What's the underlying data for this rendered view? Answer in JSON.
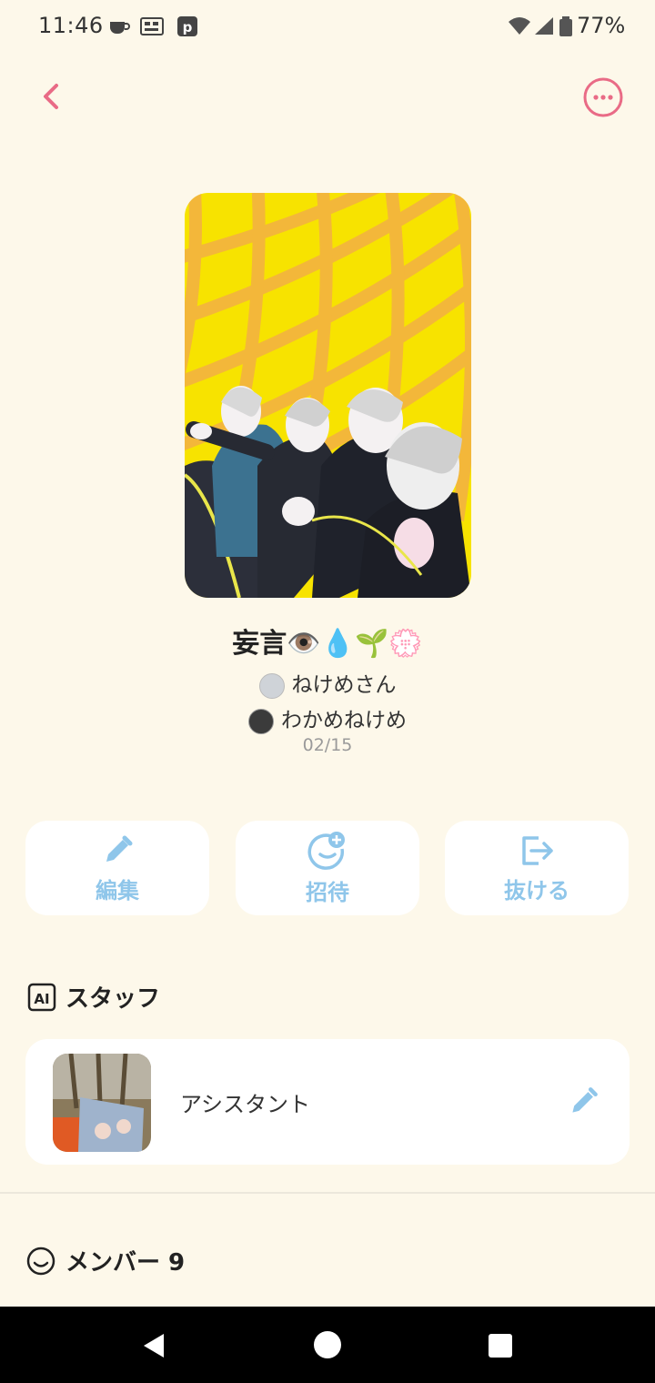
{
  "status_bar": {
    "time": "11:46",
    "battery": "77%",
    "icons": [
      "coffee-icon",
      "gallery-icon",
      "p-app-icon",
      "wifi-icon",
      "signal-icon",
      "battery-icon"
    ]
  },
  "header": {
    "back_icon": "chevron-left-icon",
    "more_icon": "more-options-icon"
  },
  "group": {
    "title": "妄言👁️💧🌱💮",
    "owners": [
      "ねけめさん",
      "わかめねけめ"
    ],
    "date": "02/15"
  },
  "actions": [
    {
      "label": "編集",
      "icon": "pencil-icon"
    },
    {
      "label": "招待",
      "icon": "invite-icon"
    },
    {
      "label": "抜ける",
      "icon": "exit-icon"
    }
  ],
  "staff": {
    "section_title": "スタッフ",
    "badge": "AI",
    "items": [
      {
        "name": "アシスタント",
        "icon": "pencil-icon"
      }
    ]
  },
  "members": {
    "section_title": "メンバー 9"
  },
  "colors": {
    "background": "#fdf8ea",
    "accent_pink": "#e96b86",
    "accent_blue": "#8fc6ea"
  }
}
